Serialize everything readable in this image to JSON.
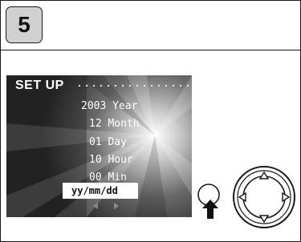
{
  "step": {
    "number": "5"
  },
  "lcd": {
    "title": "SET UP",
    "rows": {
      "year": "2003 Year",
      "month": "12 Month",
      "day": "01 Day",
      "hour": "10 Hour",
      "min": "00 Min"
    },
    "selected_format": "yy/mm/dd"
  },
  "icons": {
    "nav_arrows": "left-right-arrows-icon",
    "press_button": "round-button-icon",
    "press_arrow": "up-arrow-icon",
    "controller": "four-way-controller-icon"
  }
}
